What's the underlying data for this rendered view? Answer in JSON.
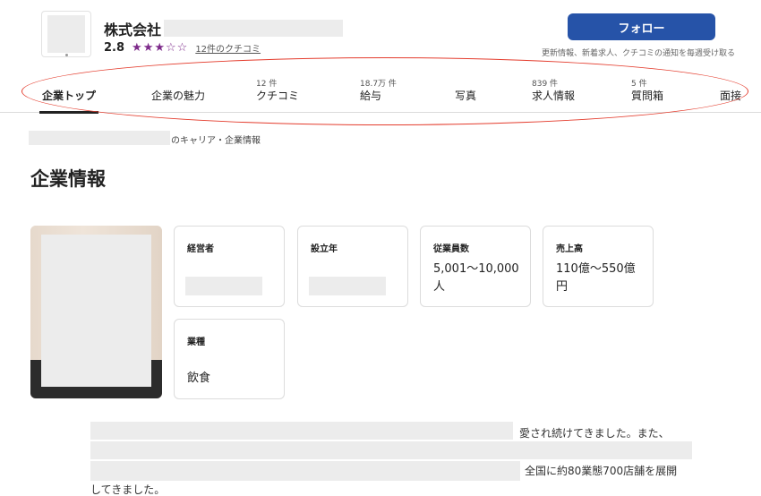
{
  "header": {
    "company_name": "株式会社",
    "rating": "2.8",
    "stars": {
      "full": 3,
      "total": 5
    },
    "review_link": "12件のクチコミ",
    "follow_label": "フォロー",
    "follow_note": "更新情報、新着求人、クチコミの通知を毎週受け取る"
  },
  "tabs": [
    {
      "count": "",
      "label": "企業トップ",
      "active": true
    },
    {
      "count": "",
      "label": "企業の魅力",
      "active": false
    },
    {
      "count": "12 件",
      "label": "クチコミ",
      "active": false
    },
    {
      "count": "18.7万 件",
      "label": "給与",
      "active": false
    },
    {
      "count": "",
      "label": "写真",
      "active": false
    },
    {
      "count": "839 件",
      "label": "求人情報",
      "active": false
    },
    {
      "count": "5 件",
      "label": "質問箱",
      "active": false
    },
    {
      "count": "",
      "label": "面接",
      "active": false
    }
  ],
  "breadcrumb": {
    "suffix": "のキャリア・企業情報"
  },
  "page_title": "企業情報",
  "cards": [
    {
      "label": "経営者",
      "value": ""
    },
    {
      "label": "設立年",
      "value": ""
    },
    {
      "label": "従業員数",
      "value": "5,001〜10,000人"
    },
    {
      "label": "売上高",
      "value": "110億〜550億円"
    },
    {
      "label": "業種",
      "value": "飲食"
    }
  ],
  "description": {
    "line1_tail": "愛され続けてきました。また、",
    "line3_tail": "全国に約80業態700店舗を展開",
    "line4": "してきました。"
  },
  "colors": {
    "follow_button": "#2653a8",
    "star": "#7d2a8a",
    "annotation_oval": "#e43d2e"
  }
}
